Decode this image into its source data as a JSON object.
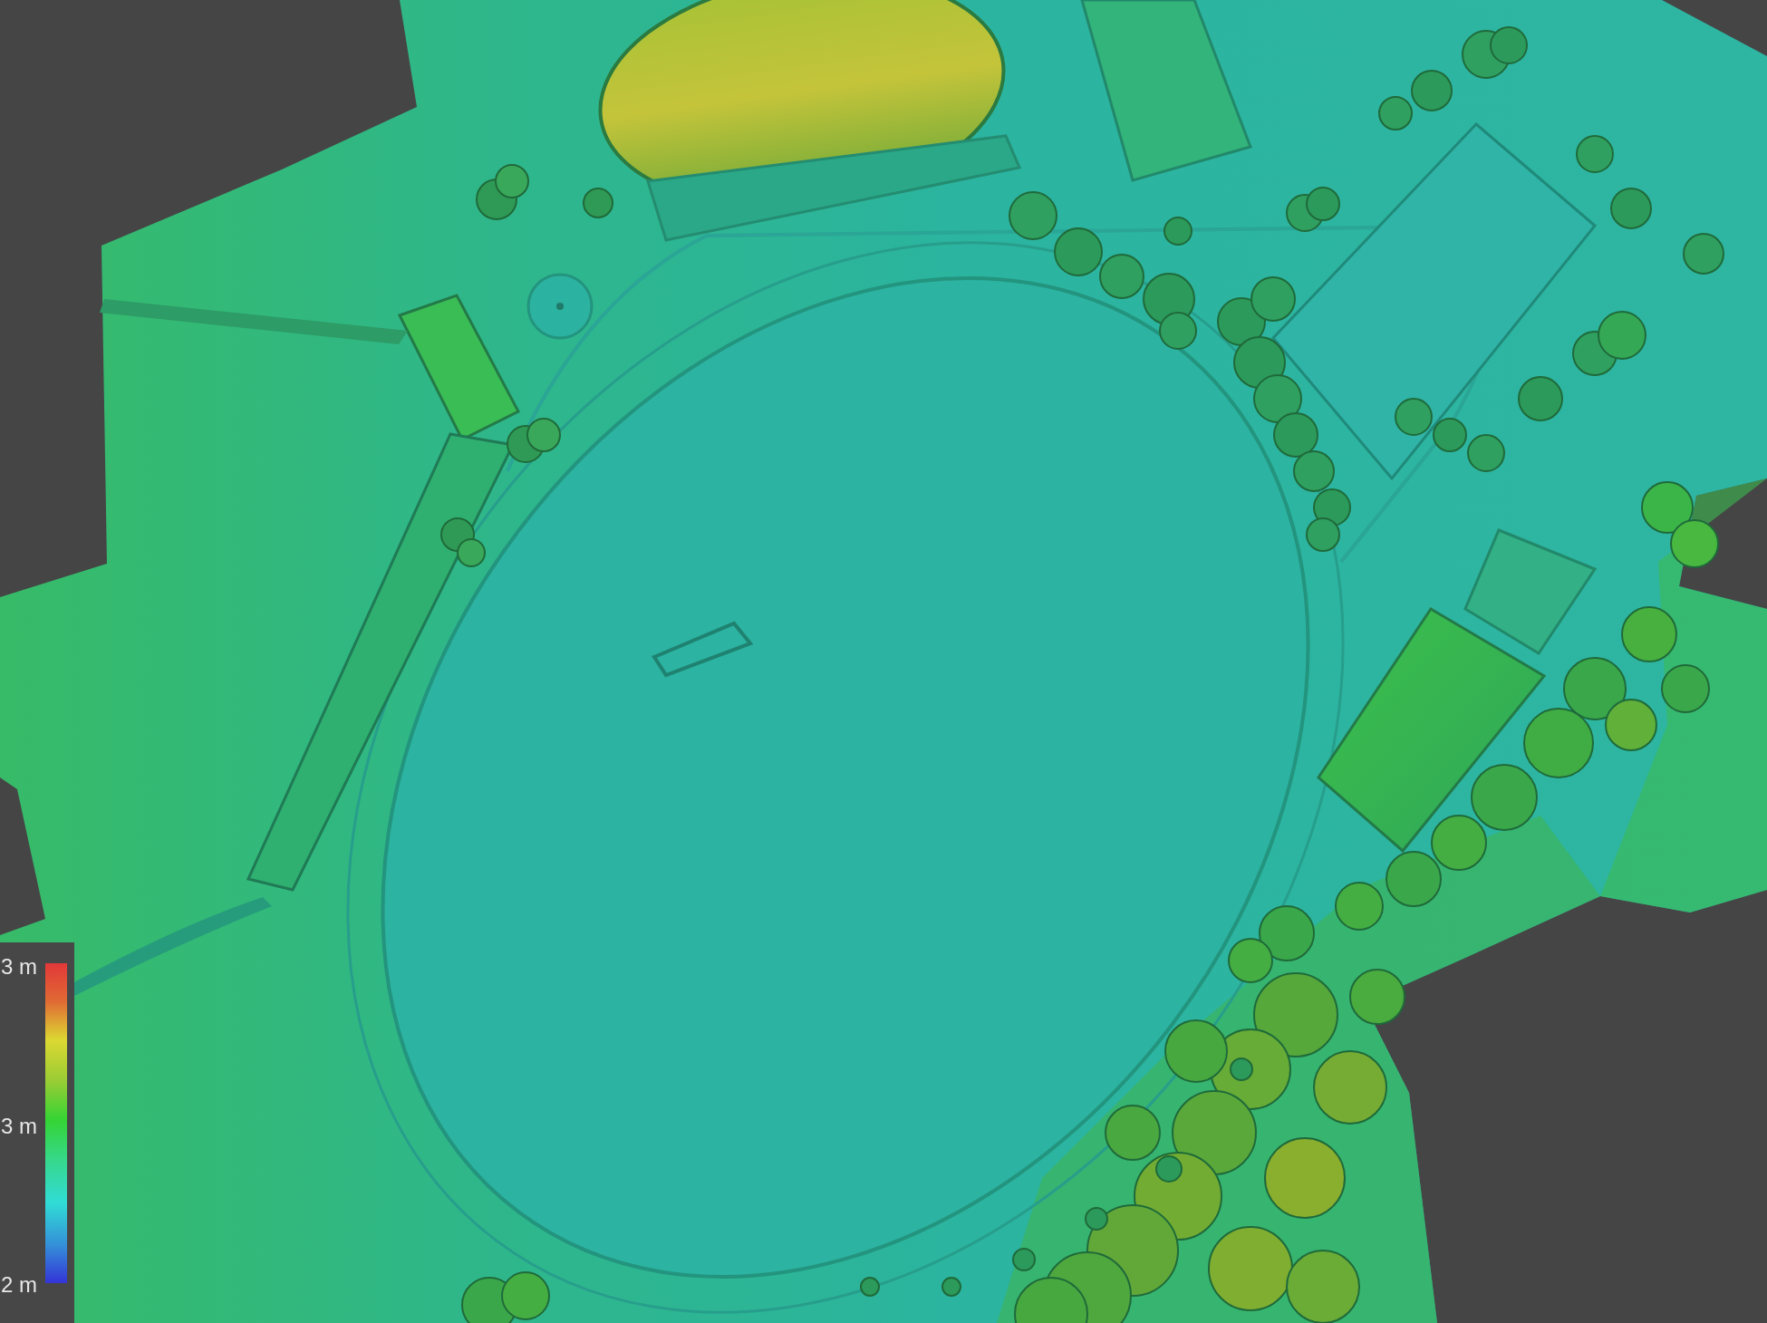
{
  "legend": {
    "labels": [
      "3 m",
      "3 m",
      "2 m"
    ]
  }
}
